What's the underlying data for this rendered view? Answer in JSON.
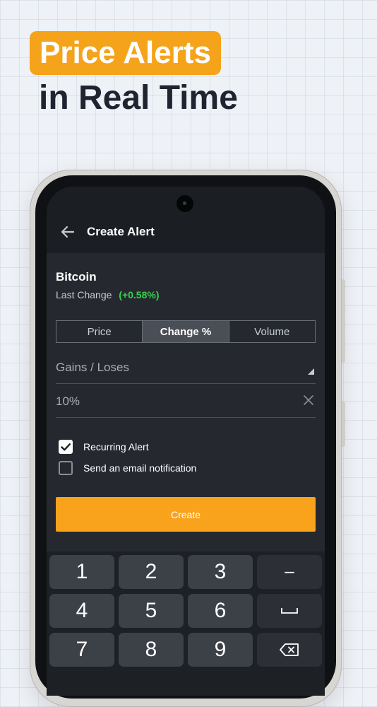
{
  "promo": {
    "headline_highlight": "Price Alerts",
    "headline_rest": "in Real Time"
  },
  "colors": {
    "accent": "#f9a21c",
    "positive": "#35d24a",
    "screen_bg": "#25292f",
    "appbar_bg": "#1b1e22"
  },
  "appbar": {
    "title": "Create Alert",
    "back_icon": "arrow-left-icon"
  },
  "asset": {
    "name": "Bitcoin",
    "last_change_label": "Last Change",
    "last_change_value": "(+0.58%)"
  },
  "tabs": [
    {
      "label": "Price",
      "active": false
    },
    {
      "label": "Change %",
      "active": true
    },
    {
      "label": "Volume",
      "active": false
    }
  ],
  "condition": {
    "selected": "Gains / Loses"
  },
  "value_input": {
    "value": "10%",
    "clear_icon": "close-icon"
  },
  "options": {
    "recurring": {
      "label": "Recurring Alert",
      "checked": true
    },
    "email": {
      "label": "Send an email notification",
      "checked": false
    }
  },
  "create_button": "Create",
  "keypad": {
    "row1": [
      "1",
      "2",
      "3",
      "–"
    ],
    "row2": [
      "4",
      "5",
      "6",
      "space-icon"
    ],
    "row3": [
      "7",
      "8",
      "9",
      "backspace-icon"
    ]
  }
}
